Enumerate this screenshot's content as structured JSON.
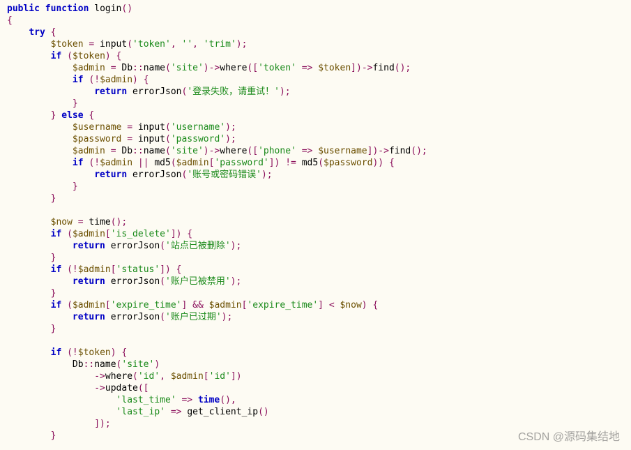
{
  "code": {
    "line01": {
      "kw1": "public",
      "kw2": "function",
      "name": "login",
      "p": "()"
    },
    "line02": {
      "p": "{"
    },
    "line03": {
      "kw": "try",
      "p": " {"
    },
    "line04": {
      "var": "$token",
      "op": " = ",
      "fn": "input",
      "p1": "(",
      "s1": "'token'",
      "c1": ", ",
      "s2": "''",
      "c2": ", ",
      "s3": "'trim'",
      "p2": ");"
    },
    "line05": {
      "kw": "if",
      "p1": " (",
      "var": "$token",
      "p2": ") {"
    },
    "line06": {
      "var1": "$admin",
      "op1": " = ",
      "cls": "Db",
      "op2": "::",
      "fn1": "name",
      "p1": "(",
      "s1": "'site'",
      "p2": ")",
      "op3": "->",
      "fn2": "where",
      "p3": "([",
      "s2": "'token'",
      "op4": " => ",
      "var2": "$token",
      "p4": "])",
      "op5": "->",
      "fn3": "find",
      "p5": "();"
    },
    "line07": {
      "kw": "if",
      "p1": " (!",
      "var": "$admin",
      "p2": ") {"
    },
    "line08": {
      "kw": "return",
      "sp": " ",
      "fn": "errorJson",
      "p1": "(",
      "s": "'登录失败，请重试！'",
      "p2": ");"
    },
    "line09": {
      "p": "}"
    },
    "line10": {
      "p1": "} ",
      "kw": "else",
      "p2": " {"
    },
    "line11": {
      "var": "$username",
      "op": " = ",
      "fn": "input",
      "p1": "(",
      "s": "'username'",
      "p2": ");"
    },
    "line12": {
      "var": "$password",
      "op": " = ",
      "fn": "input",
      "p1": "(",
      "s": "'password'",
      "p2": ");"
    },
    "line13": {
      "var1": "$admin",
      "op1": " = ",
      "cls": "Db",
      "op2": "::",
      "fn1": "name",
      "p1": "(",
      "s1": "'site'",
      "p2": ")",
      "op3": "->",
      "fn2": "where",
      "p3": "([",
      "s2": "'phone'",
      "op4": " => ",
      "var2": "$username",
      "p4": "])",
      "op5": "->",
      "fn3": "find",
      "p5": "();"
    },
    "line14": {
      "kw": "if",
      "p1": " (!",
      "var1": "$admin",
      "op1": " || ",
      "fn1": "md5",
      "p2": "(",
      "var2": "$admin",
      "p3": "[",
      "s1": "'password'",
      "p4": "]) != ",
      "fn2": "md5",
      "p5": "(",
      "var3": "$password",
      "p6": ")) {"
    },
    "line15": {
      "kw": "return",
      "sp": " ",
      "fn": "errorJson",
      "p1": "(",
      "s": "'账号或密码错误'",
      "p2": ");"
    },
    "line16": {
      "p": "}"
    },
    "line17": {
      "p": "}"
    },
    "line18": {
      "blank": ""
    },
    "line19": {
      "var": "$now",
      "op": " = ",
      "fn": "time",
      "p": "();"
    },
    "line20": {
      "kw": "if",
      "p1": " (",
      "var": "$admin",
      "p2": "[",
      "s": "'is_delete'",
      "p3": "]) {"
    },
    "line21": {
      "kw": "return",
      "sp": " ",
      "fn": "errorJson",
      "p1": "(",
      "s": "'站点已被删除'",
      "p2": ");"
    },
    "line22": {
      "p": "}"
    },
    "line23": {
      "kw": "if",
      "p1": " (!",
      "var": "$admin",
      "p2": "[",
      "s": "'status'",
      "p3": "]) {"
    },
    "line24": {
      "kw": "return",
      "sp": " ",
      "fn": "errorJson",
      "p1": "(",
      "s": "'账户已被禁用'",
      "p2": ");"
    },
    "line25": {
      "p": "}"
    },
    "line26": {
      "kw": "if",
      "p1": " (",
      "var1": "$admin",
      "p2": "[",
      "s1": "'expire_time'",
      "p3": "] && ",
      "var2": "$admin",
      "p4": "[",
      "s2": "'expire_time'",
      "p5": "] < ",
      "var3": "$now",
      "p6": ") {"
    },
    "line27": {
      "kw": "return",
      "sp": " ",
      "fn": "errorJson",
      "p1": "(",
      "s": "'账户已过期'",
      "p2": ");"
    },
    "line28": {
      "p": "}"
    },
    "line29": {
      "blank": ""
    },
    "line30": {
      "kw": "if",
      "p1": " (!",
      "var": "$token",
      "p2": ") {"
    },
    "line31": {
      "cls": "Db",
      "op1": "::",
      "fn": "name",
      "p1": "(",
      "s": "'site'",
      "p2": ")"
    },
    "line32": {
      "op": "->",
      "fn": "where",
      "p1": "(",
      "s1": "'id'",
      "c": ", ",
      "var": "$admin",
      "p2": "[",
      "s2": "'id'",
      "p3": "])"
    },
    "line33": {
      "op": "->",
      "fn": "update",
      "p": "(["
    },
    "line34": {
      "s": "'last_time'",
      "op": " => ",
      "fn": "time",
      "p": "(),"
    },
    "line35": {
      "s": "'last_ip'",
      "op": " => ",
      "fn": "get_client_ip",
      "p": "()"
    },
    "line36": {
      "p": "]);"
    },
    "line37": {
      "p": "}"
    }
  },
  "watermark": "CSDN @源码集结地"
}
